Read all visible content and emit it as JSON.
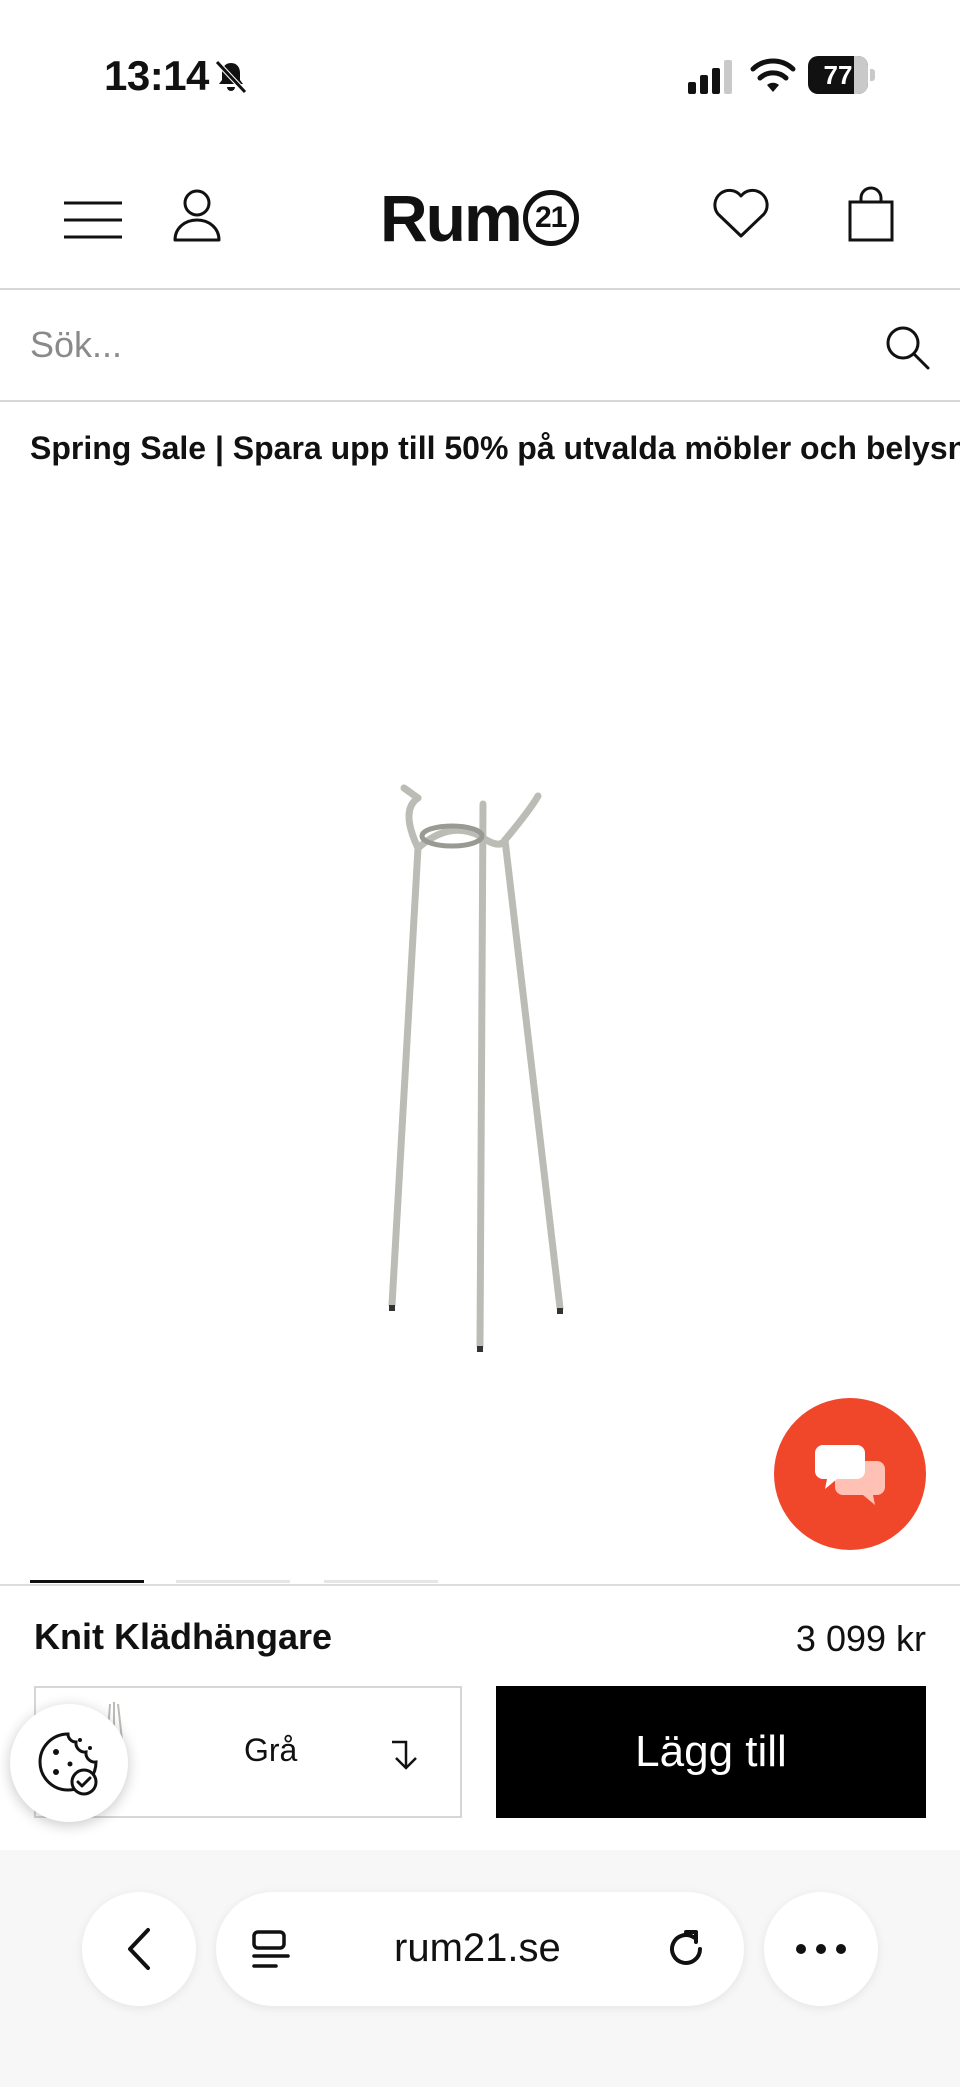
{
  "status_bar": {
    "time": "13:14",
    "battery": "77"
  },
  "header": {
    "logo_text": "Rum",
    "logo_badge": "21"
  },
  "search": {
    "placeholder": "Sök..."
  },
  "promo": {
    "text": "Spring Sale | Spara upp till 50% på utvalda möbler och belysn"
  },
  "product": {
    "name": "Knit Klädhängare",
    "price": "3 099 kr",
    "variant": "Grå",
    "add_label": "Lägg till",
    "image_count": 3,
    "active_image": 1
  },
  "browser": {
    "url": "rum21.se"
  },
  "colors": {
    "chat": "#f0462a",
    "button": "#000000",
    "product": "#bcbcb6"
  }
}
